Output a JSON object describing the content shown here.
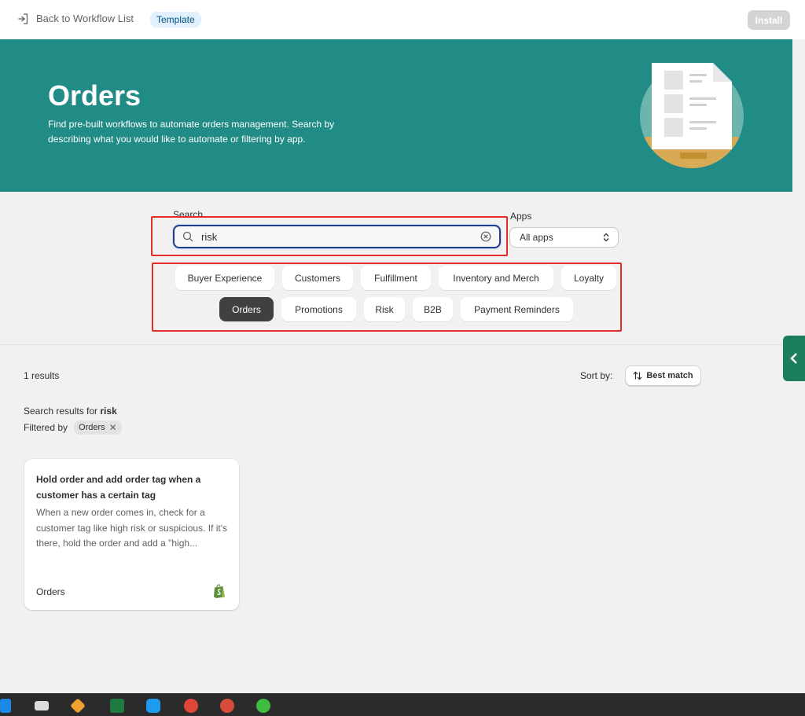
{
  "topbar": {
    "back_label": "Back to Workflow List",
    "badge": "Template",
    "install_label": "Install"
  },
  "hero": {
    "title": "Orders",
    "description": "Find pre-built workflows to automate orders management. Search by describing what you would like to automate or filtering by app."
  },
  "search": {
    "label": "Search",
    "value": "risk"
  },
  "apps": {
    "label": "Apps",
    "selected": "All apps"
  },
  "categories": [
    {
      "label": "Buyer Experience",
      "active": false
    },
    {
      "label": "Customers",
      "active": false
    },
    {
      "label": "Fulfillment",
      "active": false
    },
    {
      "label": "Inventory and Merch",
      "active": false
    },
    {
      "label": "Loyalty",
      "active": false
    },
    {
      "label": "Orders",
      "active": true
    },
    {
      "label": "Promotions",
      "active": false
    },
    {
      "label": "Risk",
      "active": false
    },
    {
      "label": "B2B",
      "active": false
    },
    {
      "label": "Payment Reminders",
      "active": false
    }
  ],
  "results": {
    "count": "1 results",
    "sort_label": "Sort by:",
    "sort_value": "Best match",
    "search_for_prefix": "Search results for",
    "search_term": "risk",
    "filtered_by_label": "Filtered by",
    "filter_tag": "Orders"
  },
  "card": {
    "title": "Hold order and add order tag when a customer has a certain tag",
    "description": "When a new order comes in, check for a customer tag like high risk or suspicious. If it's there, hold the order and add a \"high...",
    "category": "Orders"
  },
  "colors": {
    "hero_bg": "#218b85",
    "highlight": "#e32d2d",
    "side_tab": "#1a7f5a",
    "active_chip": "#404040"
  }
}
